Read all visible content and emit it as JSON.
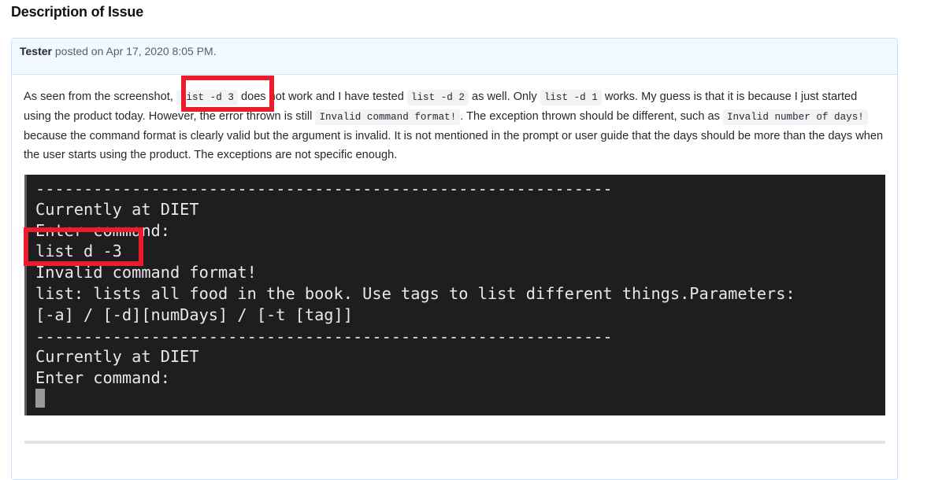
{
  "page": {
    "title": "Description of Issue"
  },
  "comment": {
    "author": "Tester",
    "posted_text": "posted on Apr 17, 2020 8:05 PM.",
    "body": {
      "p1": "As seen from the screenshot, ",
      "code1": "list -d 3",
      "p2": " does not work and I have tested ",
      "code2": "list -d 2",
      "p3": " as well. Only ",
      "code3": "list -d 1",
      "p4": " works. My guess is that it is because I just started using the product today. However, the error thrown is still ",
      "code4": "Invalid command format!",
      "p5": ". The exception thrown should be different, such as ",
      "code5": "Invalid number of days!",
      "p6": " because the command format is clearly valid but the argument is invalid. It is not mentioned in the prompt or user guide that the days should be more than the days when the user starts using the product. The exceptions are not specific enough."
    }
  },
  "terminal": {
    "lines": [
      "------------------------------------------------------------",
      "Currently at DIET",
      "Enter command:",
      "list d -3",
      "Invalid command format!",
      "list: lists all food in the book. Use tags to list different things.Parameters:",
      "[-a] / [-d][numDays] / [-t [tag]]",
      "",
      "------------------------------------------------------------",
      "Currently at DIET",
      "Enter command:"
    ]
  },
  "colors": {
    "highlight": "#ea1c2d",
    "terminal_bg": "#1e1e1e",
    "header_bg": "#f1f8ff"
  }
}
